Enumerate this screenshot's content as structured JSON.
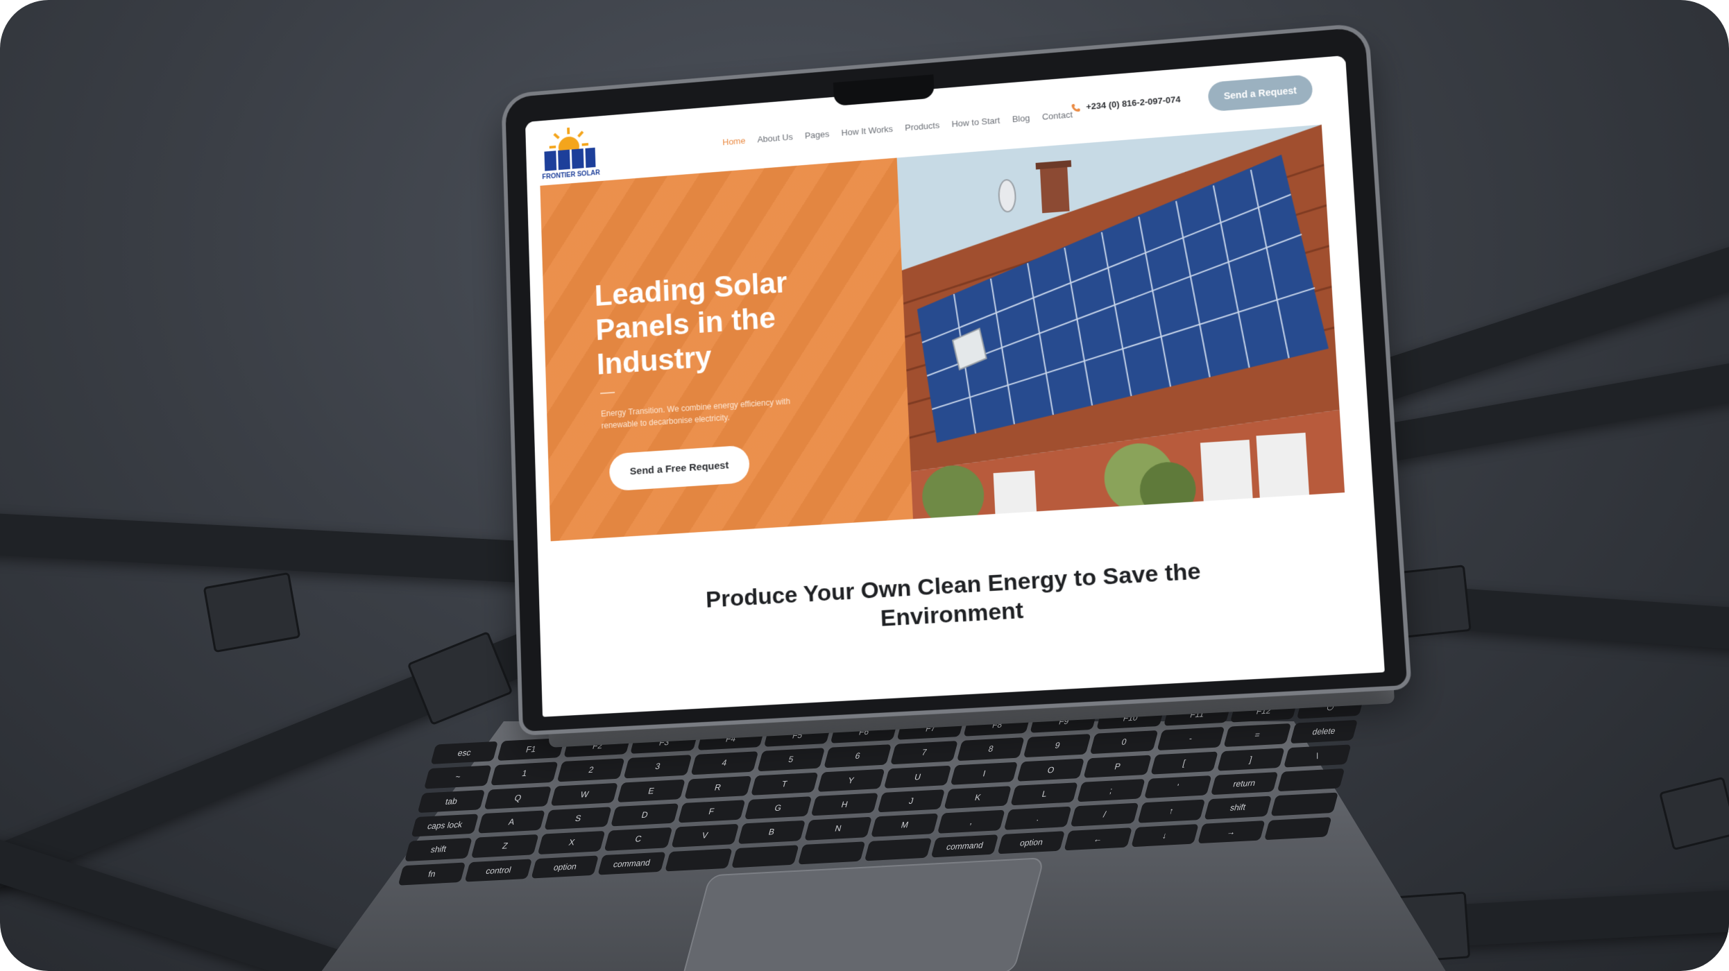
{
  "site": {
    "logo_text": "FRONTIER SOLAR",
    "nav": [
      "Home",
      "About Us",
      "Pages",
      "How It Works",
      "Products",
      "How to Start",
      "Blog",
      "Contact"
    ],
    "active_nav": "Home",
    "phone": "+234 (0) 816-2-097-074",
    "nav_cta": "Send a Request"
  },
  "hero": {
    "title": "Leading Solar Panels in the Industry",
    "text": "Energy Transition. We combine energy efficiency with renewable to decarbonise electricity.",
    "cta": "Send a Free Request"
  },
  "section": {
    "title": "Produce Your Own Clean Energy to Save the Environment"
  },
  "keyboard": {
    "keys": [
      "esc",
      "F1",
      "F2",
      "F3",
      "F4",
      "F5",
      "F6",
      "F7",
      "F8",
      "F9",
      "F10",
      "F11",
      "F12",
      "⏻",
      "~",
      "1",
      "2",
      "3",
      "4",
      "5",
      "6",
      "7",
      "8",
      "9",
      "0",
      "-",
      "=",
      "delete",
      "tab",
      "Q",
      "W",
      "E",
      "R",
      "T",
      "Y",
      "U",
      "I",
      "O",
      "P",
      "[",
      "]",
      "\\",
      "caps lock",
      "A",
      "S",
      "D",
      "F",
      "G",
      "H",
      "J",
      "K",
      "L",
      ";",
      "'",
      "return",
      "",
      "shift",
      "Z",
      "X",
      "C",
      "V",
      "B",
      "N",
      "M",
      ",",
      ".",
      "/",
      "↑",
      "shift",
      "",
      "fn",
      "control",
      "option",
      "command",
      "",
      "",
      "",
      "",
      "command",
      "option",
      "←",
      "↓",
      "→",
      ""
    ]
  },
  "colors": {
    "accent": "#ea8a43",
    "brand_blue": "#1d3f9a",
    "nav_cta_bg": "#9bb1c0",
    "background": "#2f3339"
  }
}
